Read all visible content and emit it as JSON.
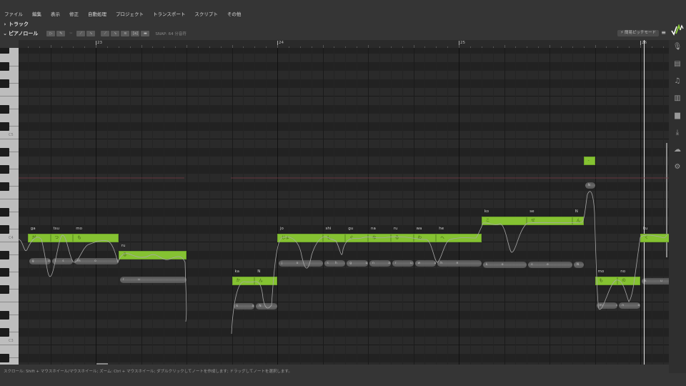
{
  "menu": [
    "ファイル",
    "編集",
    "表示",
    "修正",
    "自動処理",
    "プロジェクト",
    "トランスポート",
    "スクリプト",
    "その他"
  ],
  "track_section": {
    "label": "トラック",
    "chevron": "chevron-right-icon"
  },
  "pianoroll_section": {
    "label": "ピアノロール",
    "chevron": "chevron-down-icon",
    "snap_label": "SNAP:",
    "snap_value": "64 分音符",
    "pitch_mode": "⚡ 簡易ピッチモード",
    "menu_icon": "hamburger-icon"
  },
  "toolbar_icons": [
    "pointer-tool-icon",
    "pen-tool-icon",
    "scissors-tool-icon",
    "note-mode-icon",
    "pitch-mode-icon",
    "pitch-line-icon",
    "vibrato-icon",
    "waveform-icon",
    "phoneme-icon",
    "sidebar-icon"
  ],
  "sidebar_icons": [
    "microphone-icon",
    "film-icon",
    "music-note-icon",
    "library-icon",
    "book-icon",
    "render-icon",
    "cloud-icon",
    "gear-icon"
  ],
  "measures": [
    {
      "number": "23",
      "beat": 0
    },
    {
      "number": "24",
      "beat": 4
    },
    {
      "number": "25",
      "beat": 8
    },
    {
      "number": "26",
      "beat": 12
    }
  ],
  "key_labels": [
    {
      "label": "C5",
      "pitch": 72
    },
    {
      "label": "C4",
      "pitch": 60
    },
    {
      "label": "C3",
      "pitch": 48
    }
  ],
  "notes": [
    {
      "phoneme_label": "ga",
      "lyric": "が",
      "pitch": 60,
      "start": -1.5,
      "length": 0.5,
      "wave": "g a"
    },
    {
      "phoneme_label": "tsu",
      "lyric": "つ",
      "pitch": 60,
      "start": -1.0,
      "length": 0.5,
      "wave": "ts u"
    },
    {
      "phoneme_label": "mo",
      "lyric": "も",
      "pitch": 60,
      "start": -0.5,
      "length": 1.0,
      "wave": "m o"
    },
    {
      "phoneme_label": "ru",
      "lyric": "る",
      "pitch": 58,
      "start": 0.5,
      "length": 1.5,
      "wave": "r u"
    },
    {
      "phoneme_label": "ka",
      "lyric": "か",
      "pitch": 55,
      "start": 3.0,
      "length": 0.5,
      "wave": "k a"
    },
    {
      "phoneme_label": "N",
      "lyric": "ん",
      "pitch": 55,
      "start": 3.5,
      "length": 0.5,
      "wave": "N"
    },
    {
      "phoneme_label": "jo",
      "lyric": "じょ",
      "pitch": 60,
      "start": 4.0,
      "length": 1.0,
      "wave": "j o"
    },
    {
      "phoneme_label": "shi",
      "lyric": "し",
      "pitch": 60,
      "start": 5.0,
      "length": 0.5,
      "wave": "sh i"
    },
    {
      "phoneme_label": "gu",
      "lyric": "ぐ",
      "pitch": 60,
      "start": 5.5,
      "length": 0.5,
      "wave": "g u"
    },
    {
      "phoneme_label": "na",
      "lyric": "な",
      "pitch": 60,
      "start": 6.0,
      "length": 0.5,
      "wave": "n a"
    },
    {
      "phoneme_label": "ru",
      "lyric": "る",
      "pitch": 60,
      "start": 6.5,
      "length": 0.5,
      "wave": "r u"
    },
    {
      "phoneme_label": "wa",
      "lyric": "わ",
      "pitch": 60,
      "start": 7.0,
      "length": 0.5,
      "wave": "w a"
    },
    {
      "phoneme_label": "he",
      "lyric": "へ",
      "pitch": 60,
      "start": 7.5,
      "length": 1.0,
      "wave": "h e"
    },
    {
      "phoneme_label": "ko",
      "lyric": "こ",
      "pitch": 62,
      "start": 8.5,
      "length": 1.0,
      "wave": "k o"
    },
    {
      "phoneme_label": "se",
      "lyric": "せ",
      "pitch": 62,
      "start": 9.5,
      "length": 1.0,
      "wave": "s e"
    },
    {
      "phoneme_label": "N",
      "lyric": "ん",
      "pitch": 62,
      "start": 10.5,
      "length": 0.25,
      "wave": "N m"
    },
    {
      "phoneme_label": "",
      "lyric": "-",
      "pitch": 69,
      "start": 10.75,
      "length": 0.25,
      "wave": "N m o"
    },
    {
      "phoneme_label": "mo",
      "lyric": "も",
      "pitch": 55,
      "start": 11.0,
      "length": 0.5,
      "wave": "m o"
    },
    {
      "phoneme_label": "no",
      "lyric": "の",
      "pitch": 55,
      "start": 11.5,
      "length": 0.5,
      "wave": "n o k"
    },
    {
      "phoneme_label": "ku",
      "lyric": "く",
      "pitch": 60,
      "start": 12.0,
      "length": 0.75,
      "wave": "k u"
    }
  ],
  "status_text": "スクロール: Shift + マウスホイール/マウスホイール; ズーム: Ctrl + マウスホイール; ダブルクリックしてノートを作成します; ドラッグしてノートを選択します。",
  "colors": {
    "note": "#85c232",
    "accent": "#8ed13a",
    "background": "#282828",
    "pitch_curve": "#a8a8a8",
    "reference_line": "#7a3a44"
  }
}
